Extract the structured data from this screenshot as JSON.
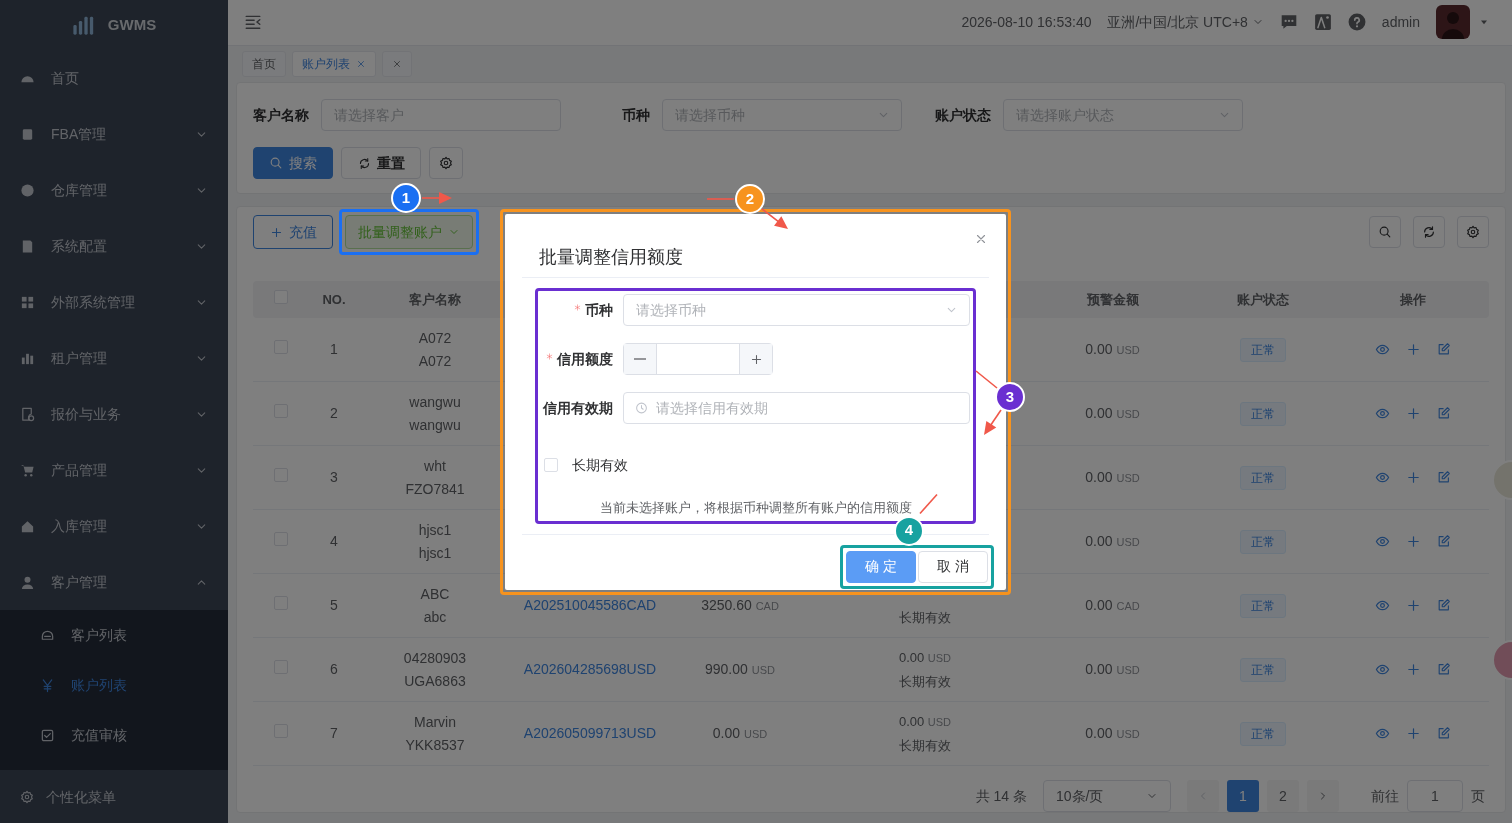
{
  "sidebar": {
    "logo": "GWMS",
    "items": [
      {
        "label": "首页",
        "expandable": false
      },
      {
        "label": "FBA管理",
        "expandable": true,
        "expanded": false
      },
      {
        "label": "仓库管理",
        "expandable": true,
        "expanded": false
      },
      {
        "label": "系统配置",
        "expandable": true,
        "expanded": false
      },
      {
        "label": "外部系统管理",
        "expandable": true,
        "expanded": false
      },
      {
        "label": "租户管理",
        "expandable": true,
        "expanded": false
      },
      {
        "label": "报价与业务",
        "expandable": true,
        "expanded": false
      },
      {
        "label": "产品管理",
        "expandable": true,
        "expanded": false
      },
      {
        "label": "入库管理",
        "expandable": true,
        "expanded": false
      },
      {
        "label": "客户管理",
        "expandable": true,
        "expanded": true,
        "children": [
          {
            "label": "客户列表",
            "selected": false
          },
          {
            "label": "账户列表",
            "selected": true
          },
          {
            "label": "充值审核",
            "selected": false
          }
        ]
      }
    ],
    "footer": "个性化菜单"
  },
  "header": {
    "datetime": "2026-08-10 16:53:40",
    "timezone": "亚洲/中国/北京 UTC+8",
    "user": "admin"
  },
  "tabs": [
    {
      "label": "首页",
      "selected": false,
      "closable": false
    },
    {
      "label": "账户列表",
      "selected": true,
      "closable": true
    }
  ],
  "filters": [
    {
      "label": "客户名称",
      "placeholder": "请选择客户",
      "kind": "input"
    },
    {
      "label": "币种",
      "placeholder": "请选择币种",
      "kind": "select"
    },
    {
      "label": "账户状态",
      "placeholder": "请选择账户状态",
      "kind": "select"
    }
  ],
  "filter_buttons": [
    {
      "label": "搜索",
      "kind": "primary"
    },
    {
      "label": "重置",
      "kind": "default"
    }
  ],
  "toolbar": {
    "recharge": "充值",
    "batch": "批量调整账户"
  },
  "table": {
    "all_selected": false,
    "left_columns": [
      "NO.",
      "客户名称"
    ],
    "right_columns": [
      "预警金额",
      "账户状态",
      "操作"
    ],
    "rows": [
      {
        "selected": false,
        "no": "1",
        "customer": [
          "A072",
          "A072"
        ],
        "warning": {
          "amount": "0.00",
          "currency": "USD"
        },
        "status": "正常"
      },
      {
        "selected": false,
        "no": "2",
        "customer": [
          "wangwu",
          "wangwu"
        ],
        "warning": {
          "amount": "0.00",
          "currency": "USD"
        },
        "status": "正常"
      },
      {
        "selected": false,
        "no": "3",
        "customer": [
          "wht",
          "FZO7841"
        ],
        "warning": {
          "amount": "0.00",
          "currency": "USD"
        },
        "status": "正常"
      },
      {
        "selected": false,
        "no": "4",
        "customer": [
          "hjsc1",
          "hjsc1"
        ],
        "warning": {
          "amount": "0.00",
          "currency": "USD"
        },
        "status": "正常"
      },
      {
        "selected": false,
        "no": "5",
        "customer": [
          "ABC",
          "abc"
        ],
        "account": "A202510045586CAD",
        "balance": {
          "amount": "3250.60",
          "currency": "CAD"
        },
        "credit_note": "长期有效",
        "warning": {
          "amount": "0.00",
          "currency": "CAD"
        },
        "status": "正常"
      },
      {
        "selected": false,
        "no": "6",
        "customer": [
          "04280903",
          "UGA6863"
        ],
        "account": "A202604285698USD",
        "balance": {
          "amount": "990.00",
          "currency": "USD"
        },
        "credit": {
          "amount": "0.00",
          "currency": "USD"
        },
        "credit_note": "长期有效",
        "warning": {
          "amount": "0.00",
          "currency": "USD"
        },
        "status": "正常"
      },
      {
        "selected": false,
        "no": "7",
        "customer": [
          "Marvin",
          "YKK8537"
        ],
        "account": "A202605099713USD",
        "balance": {
          "amount": "0.00",
          "currency": "USD"
        },
        "credit": {
          "amount": "0.00",
          "currency": "USD"
        },
        "credit_note": "长期有效",
        "warning": {
          "amount": "0.00",
          "currency": "USD"
        },
        "status": "正常"
      }
    ]
  },
  "pagination": {
    "total": "共 14 条",
    "page_size": "10条/页",
    "pages": [
      {
        "label": "1",
        "selected": true
      },
      {
        "label": "2",
        "selected": false
      }
    ],
    "goto_label": "前往",
    "goto_value": "1",
    "page_suffix": "页"
  },
  "modal": {
    "title": "批量调整信用额度",
    "fields": [
      {
        "label": "币种",
        "required": true,
        "kind": "select",
        "placeholder": "请选择币种"
      },
      {
        "label": "信用额度",
        "required": true,
        "kind": "number"
      },
      {
        "label": "信用有效期",
        "required": false,
        "kind": "date",
        "placeholder": "请选择信用有效期"
      },
      {
        "label": "长期有效",
        "kind": "checkbox",
        "checked": false
      }
    ],
    "note": "当前未选择账户，将根据币种调整所有账户的信用额度",
    "buttons": [
      {
        "label": "确 定",
        "kind": "primary"
      },
      {
        "label": "取 消",
        "kind": "default"
      }
    ]
  },
  "annotations": [
    {
      "number": "1",
      "color": "#1a6ff2"
    },
    {
      "number": "2",
      "color": "#f7931e"
    },
    {
      "number": "3",
      "color": "#6a2fd1"
    },
    {
      "number": "4",
      "color": "#17a2a0"
    }
  ]
}
